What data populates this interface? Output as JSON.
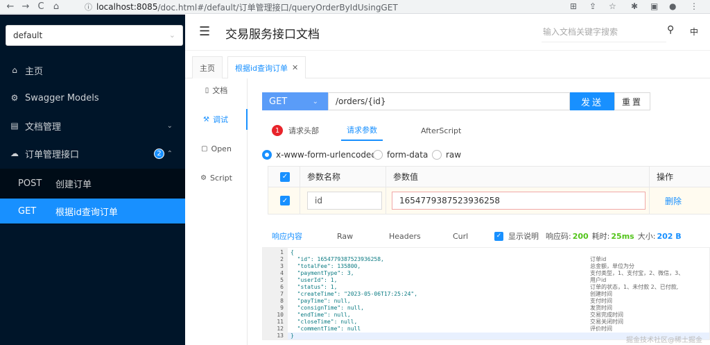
{
  "browser": {
    "url_host": "localhost:8085",
    "url_path": "/doc.html#/default/订单管理接口/queryOrderByIdUsingGET"
  },
  "sidebar": {
    "group_select": "default",
    "items": [
      {
        "label": "主页",
        "icon": "home-icon"
      },
      {
        "label": "Swagger Models",
        "icon": "models-icon"
      },
      {
        "label": "文档管理",
        "icon": "doc-manage-icon"
      },
      {
        "label": "订单管理接口",
        "icon": "cloud-icon",
        "badge": "2"
      }
    ],
    "sub_items": [
      {
        "method": "POST",
        "label": "创建订单"
      },
      {
        "method": "GET",
        "label": "根据id查询订单"
      }
    ]
  },
  "header": {
    "title": "交易服务接口文档",
    "search_placeholder": "输入文档关键字搜索",
    "lang": "中"
  },
  "tabs": [
    {
      "label": "主页"
    },
    {
      "label": "根据id查询订单"
    }
  ],
  "leftnav": [
    {
      "label": "文档"
    },
    {
      "label": "调试"
    },
    {
      "label": "Open"
    },
    {
      "label": "Script"
    }
  ],
  "request": {
    "method": "GET",
    "url": "/orders/{id}",
    "send_label": "发送",
    "reset_label": "重置"
  },
  "request_tabs": {
    "headers_badge": "1",
    "headers": "请求头部",
    "params": "请求参数",
    "after": "AfterScript"
  },
  "body_types": [
    "x-www-form-urlencoded",
    "form-data",
    "raw"
  ],
  "param_table": {
    "headers": [
      "参数名称",
      "参数值",
      "操作"
    ],
    "row": {
      "name": "id",
      "value": "1654779387523936258",
      "action": "删除"
    }
  },
  "response": {
    "tabs": [
      "响应内容",
      "Raw",
      "Headers",
      "Curl"
    ],
    "show_desc": "显示说明",
    "code_label": "响应码:",
    "code": "200",
    "time_label": "耗时:",
    "time": "25ms",
    "size_label": "大小:",
    "size": "202 B"
  },
  "code_lines": [
    {
      "num": "1",
      "text": "{"
    },
    {
      "num": "2",
      "text": "  \"id\": 1654779387523936258,"
    },
    {
      "num": "3",
      "text": "  \"totalFee\": 135800,"
    },
    {
      "num": "4",
      "text": "  \"paymentType\": 3,"
    },
    {
      "num": "5",
      "text": "  \"userId\": 1,"
    },
    {
      "num": "6",
      "text": "  \"status\": 1,"
    },
    {
      "num": "7",
      "text": "  \"createTime\": \"2023-05-06T17:25:24\","
    },
    {
      "num": "8",
      "text": "  \"payTime\": null,"
    },
    {
      "num": "9",
      "text": "  \"consignTime\": null,"
    },
    {
      "num": "10",
      "text": "  \"endTime\": null,"
    },
    {
      "num": "11",
      "text": "  \"closeTime\": null,"
    },
    {
      "num": "12",
      "text": "  \"commentTime\": null"
    },
    {
      "num": "13",
      "text": "}"
    }
  ],
  "comments": [
    "订单id",
    "总金额，单位为分",
    "支付类型，1、支付宝，2、微信，3、",
    "用户id",
    "订单的状态，1、未付款 2、已付款,",
    "创建时间",
    "支付时间",
    "发货时间",
    "交易完成时间",
    "交易关闭时间",
    "评价时间"
  ],
  "watermark": "掘金技术社区@稀土掘金"
}
